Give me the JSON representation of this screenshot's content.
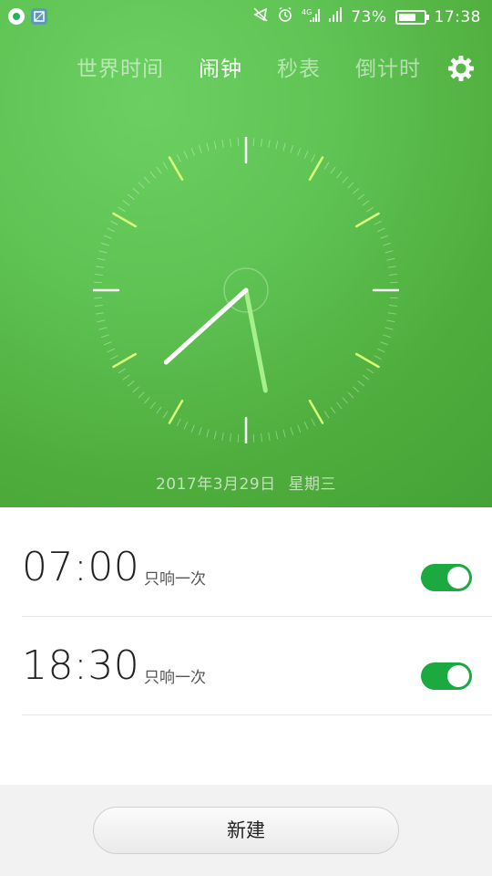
{
  "status_bar": {
    "battery_percent": "73%",
    "battery_level": 0.73,
    "time": "17:38",
    "left_icons": [
      "app-notification-icon",
      "screenshot-icon"
    ],
    "right_icons": [
      "mute-icon",
      "alarm-icon",
      "signal-4g-icon",
      "signal-bars-icon"
    ]
  },
  "tabs": [
    {
      "label": "世界时间",
      "active": false
    },
    {
      "label": "闹钟",
      "active": true
    },
    {
      "label": "秒表",
      "active": false
    },
    {
      "label": "倒计时",
      "active": false
    }
  ],
  "settings_icon": "gear-icon",
  "clock": {
    "hour": 5,
    "minute": 38
  },
  "date": {
    "date_text": "2017年3月29日",
    "weekday": "星期三"
  },
  "alarms": [
    {
      "time": "07:00",
      "repeat": "只响一次",
      "enabled": true
    },
    {
      "time": "18:30",
      "repeat": "只响一次",
      "enabled": true
    }
  ],
  "new_button_label": "新建",
  "colors": {
    "hero_green": "#5fc454",
    "toggle_on": "#1ba940",
    "tick_accent": "#d8ff7a"
  }
}
